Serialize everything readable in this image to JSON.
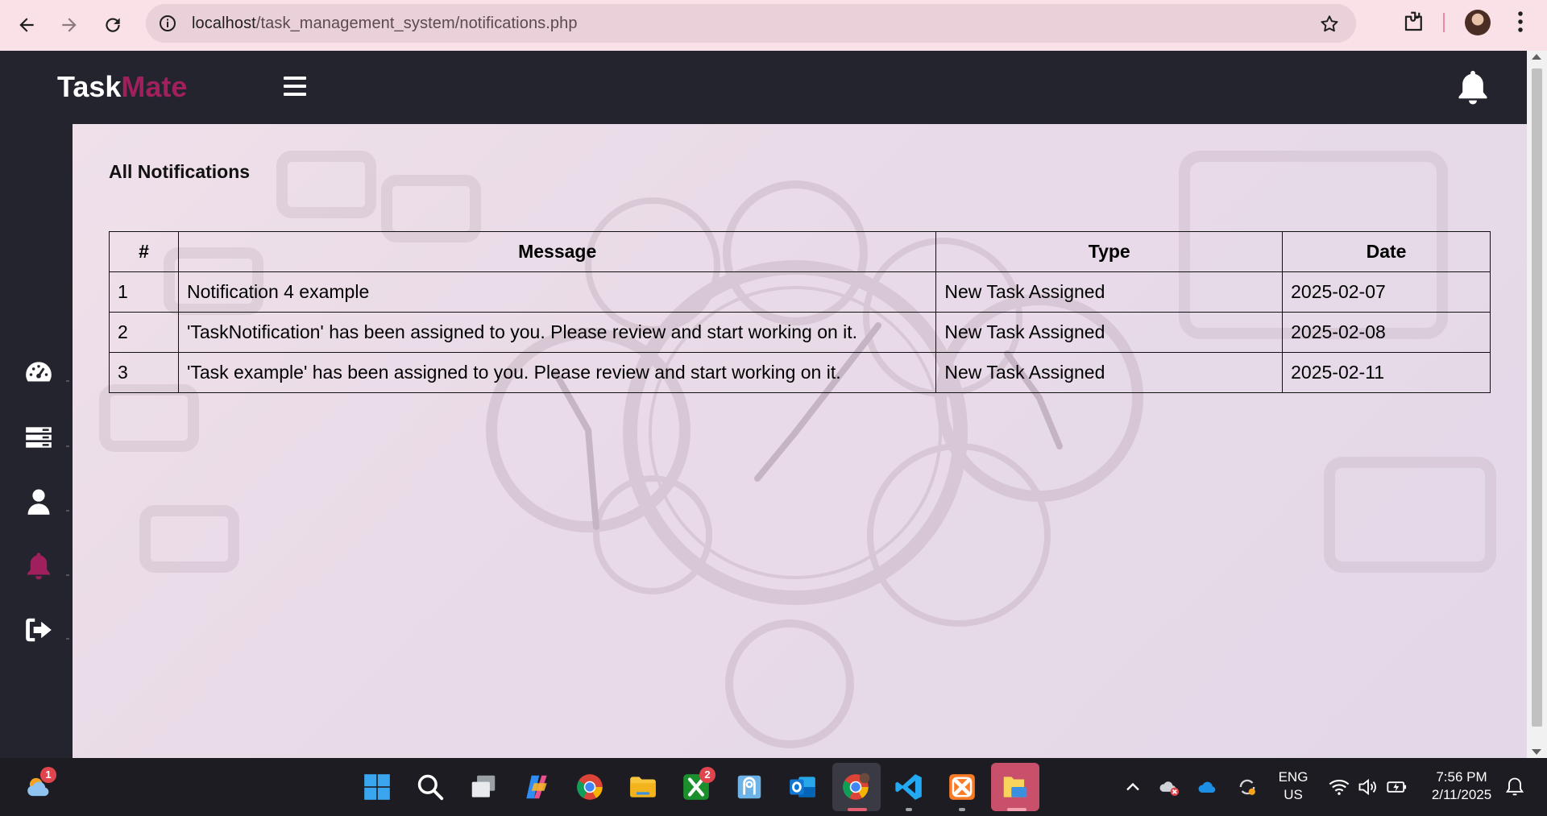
{
  "browser": {
    "url_host": "localhost",
    "url_path": "/task_management_system/notifications.php"
  },
  "app": {
    "logo_part1": "Task",
    "logo_part2": "Mate",
    "brand_color": "#a0205e"
  },
  "sidebar": {
    "items": [
      {
        "icon": "dashboard-icon"
      },
      {
        "icon": "tasks-list-icon"
      },
      {
        "icon": "user-icon"
      },
      {
        "icon": "bell-icon",
        "active": true
      },
      {
        "icon": "logout-icon"
      }
    ]
  },
  "main": {
    "title": "All Notifications",
    "table": {
      "headers": [
        "#",
        "Message",
        "Type",
        "Date"
      ],
      "rows": [
        {
          "num": "1",
          "message": "Notification 4 example",
          "type": "New Task Assigned",
          "date": "2025-02-07"
        },
        {
          "num": "2",
          "message": "'TaskNotification' has been assigned to you. Please review and start working on it.",
          "type": "New Task Assigned",
          "date": "2025-02-08"
        },
        {
          "num": "3",
          "message": "'Task example' has been assigned to you. Please review and start working on it.",
          "type": "New Task Assigned",
          "date": "2025-02-11"
        }
      ]
    }
  },
  "taskbar": {
    "weather_badge": "1",
    "xbox_badge": "2",
    "language_line1": "ENG",
    "language_line2": "US",
    "time": "7:56 PM",
    "date": "2/11/2025"
  }
}
